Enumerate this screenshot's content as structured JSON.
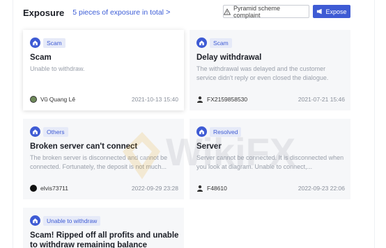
{
  "header": {
    "title": "Exposure",
    "count_text": "5 pieces of exposure in total",
    "chevron_glyph": ">",
    "complaint_label": "Pyramid scheme complaint",
    "expose_label": "Expose"
  },
  "cards": [
    {
      "badge": "Scam",
      "title": "Scam",
      "desc": "Unable to withdraw.",
      "user": "Vũ Quang Lê",
      "date": "2021-10-13 15:40"
    },
    {
      "badge": "Scam",
      "title": "Delay withdrawal",
      "desc": "The withdrawal was delayed and the customer service didn't reply or even closed the dialogue.",
      "user": "FX2159858530",
      "date": "2021-07-21 15:46"
    },
    {
      "badge": "Others",
      "title": "Broken server can't connect",
      "desc": "The broken server is disconnected and cannot be connected. Fortunately, the deposit is not much...",
      "user": "elvis73711",
      "date": "2022-09-29 23:28"
    },
    {
      "badge": "Resolved",
      "title": "Server",
      "desc": "Server cannot be connected. It is disconnected when you look at diagram. Unable to connect,...",
      "user": "F48610",
      "date": "2022-09-23 22:06"
    },
    {
      "badge": "Unable to withdraw",
      "title": "Scam! Ripped off all profits and unable to withdraw remaining balance"
    }
  ],
  "colors": {
    "accent": "#3e5bd4",
    "badge_bg": "#e6eaf8"
  }
}
